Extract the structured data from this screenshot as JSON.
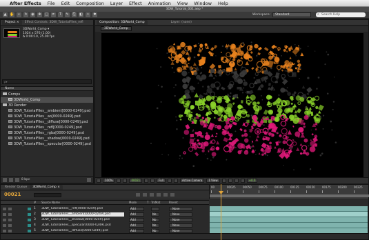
{
  "menubar": {
    "app_name": "After Effects",
    "items": [
      "File",
      "Edit",
      "Composition",
      "Layer",
      "Effect",
      "Animation",
      "View",
      "Window",
      "Help"
    ]
  },
  "title": "3DW_Tutorial_001.aep *",
  "toolbar": {
    "workspace_label": "Workspace:",
    "workspace_value": "Standard",
    "help_placeholder": "Search Help"
  },
  "project": {
    "tabs": [
      "Project ×",
      "Effect Controls: 3DW_TutorialFiles_refl"
    ],
    "selected_name": "3DWorld_Comp ▾",
    "selected_size": "1024 x 576 (1.00)",
    "selected_duration": "Δ 0:00:10, 25.00 fps",
    "search_placeholder": "ρ▾",
    "column_header": "Name",
    "items": [
      {
        "name": "Comps",
        "type": "folder",
        "indent": 0
      },
      {
        "name": "3DWorld_Comp",
        "type": "comp",
        "indent": 1
      },
      {
        "name": "3D Render",
        "type": "folder",
        "indent": 0
      },
      {
        "name": "3DW_TutorialFiles__ambient[0000-0249].psd",
        "type": "file",
        "indent": 1
      },
      {
        "name": "3DW_TutorialFiles__ao[0000-0249].psd",
        "type": "file",
        "indent": 1
      },
      {
        "name": "3DW_TutorialFiles__diffuse[0000-0249].psd",
        "type": "file",
        "indent": 1
      },
      {
        "name": "3DW_TutorialFiles__refl[0000-0249].psd",
        "type": "file",
        "indent": 1
      },
      {
        "name": "3DW_TutorialFiles__rgba[0000-0249].psd",
        "type": "file",
        "indent": 1
      },
      {
        "name": "3DW_TutorialFiles__shadow[0000-0249].psd",
        "type": "file",
        "indent": 1
      },
      {
        "name": "3DW_TutorialFiles__specular[0000-0249].psd",
        "type": "file",
        "indent": 1
      }
    ],
    "bit_depth": "8 bpc"
  },
  "composition": {
    "tab_label": "Composition: 3DWorld_Comp",
    "layer_tab": "Layer: (none)",
    "sub_tab": "3DWorld_Comp",
    "zoom": "100%",
    "timecode": "00021",
    "resolution": "Full",
    "camera": "Active Camera",
    "views": "1 View",
    "exposure": "+0.0"
  },
  "timeline": {
    "tabs": [
      "Render Queue",
      "3DWorld_Comp ×"
    ],
    "timecode": "00021",
    "columns": {
      "source": "Source Name",
      "mode": "Mode",
      "t": "T",
      "trkmat": "TrkMat",
      "parent": "Parent"
    },
    "ruler_labels": [
      "00",
      "00025",
      "00050",
      "00075",
      "00100",
      "00125",
      "00150",
      "00175",
      "00200",
      "00225"
    ],
    "layers": [
      {
        "num": "1",
        "name": "3DW_TutorialFiles__refl[0000-0249].psd",
        "mode": "Add",
        "trkmat": "",
        "parent": "None",
        "selected": false
      },
      {
        "num": "2",
        "name": "3DW_TutorialFiles__ambient[0000-0249].psd",
        "mode": "Add",
        "trkmat": "No",
        "parent": "None",
        "selected": true
      },
      {
        "num": "3",
        "name": "3DW_TutorialFiles__shadow[0000-0249].psd",
        "mode": "Add",
        "trkmat": "No",
        "parent": "None",
        "selected": false
      },
      {
        "num": "4",
        "name": "3DW_TutorialFiles__specular[0000-0249].psd",
        "mode": "Add",
        "trkmat": "No",
        "parent": "None",
        "selected": false
      },
      {
        "num": "5",
        "name": "3DW_TutorialFiles__diffuse[0000-0249].psd",
        "mode": "Add",
        "trkmat": "No",
        "parent": "None",
        "selected": false
      }
    ]
  },
  "colors": {
    "orange": "#e8821e",
    "pink": "#e0197a",
    "green": "#8ad22a",
    "dark": "#3a3a3a",
    "timecode": "#e0a43a",
    "layer_bar": "#7fb3ad"
  }
}
